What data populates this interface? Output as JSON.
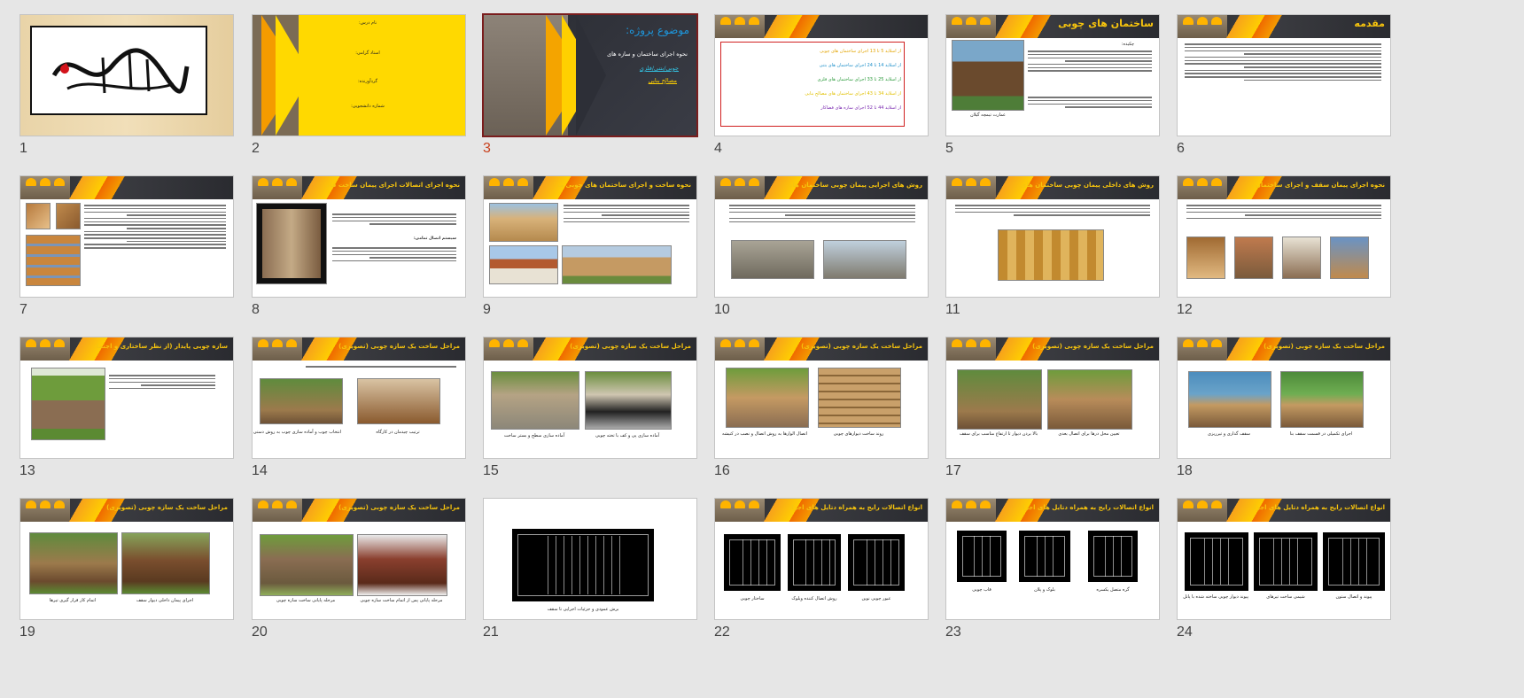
{
  "slides": [
    {
      "num": "1"
    },
    {
      "num": "2",
      "fields": [
        "نام درس:",
        "استاد گرامی:",
        "گردآورنده:",
        "شماره دانشجویی:"
      ]
    },
    {
      "num": "3",
      "title": "موضوع پروژه:",
      "l1": "نحوه اجرای ساختمان و سازه های",
      "l2": "چوبی/بتنی/فلزی",
      "l3": "مصالح بنایی"
    },
    {
      "num": "4",
      "rows": [
        "از اسلاید 5 تا 13 اجرای ساختمان های چوبی",
        "از اسلاید 14 تا 24 اجرای ساختمان های بتنی",
        "از اسلاید 25 تا 33 اجرای ساختمان های فلزی",
        "از اسلاید 34 تا 43 اجرای ساختمان های مصالح بنایی",
        "از اسلاید 44 تا 52 اجرای سازه های فضاکار"
      ],
      "row_colors": [
        "#e3a400",
        "#1d8fc9",
        "#2a9a3a",
        "#e0c000",
        "#7a2ab0"
      ]
    },
    {
      "num": "5",
      "title": "ساختمان های چوبی",
      "caption": "عمارت تیمچه گیلان",
      "intro": "چکیده:"
    },
    {
      "num": "6",
      "title": "مقدمه"
    },
    {
      "num": "7"
    },
    {
      "num": "8",
      "title": "نحوه اجرای اتصالات اجرای پیمان ساخت قاب چوبی مقاوم در برابر زلزله",
      "sub": "سیستم اتصال تمامی:"
    },
    {
      "num": "9",
      "title": "نحوه ساخت و اجرای ساختمان های چوبی مقاوم در برابر زلزله"
    },
    {
      "num": "10",
      "title": "روش های اجرایی پیمان چوبی ساختمان های چوبی مقاوم در برابر زلزله"
    },
    {
      "num": "11",
      "title": "روش های داخلی پیمان چوبی ساختمان های چوبی مقاوم در برابر زلزله"
    },
    {
      "num": "12",
      "title": "نحوه اجرای پیمان سقف و اجرای ساختمان های چوبی مقاوم در برابر زلزله"
    },
    {
      "num": "13",
      "title": "سازه چوبی پایدار (از نظر ساختاری و اجتماعی)"
    },
    {
      "num": "14",
      "title": "مراحل ساخت یک سازه چوبی (تصویری)",
      "caps": [
        "انتخاب چوب و آماده سازی چوب به روش دستی در کارگاه",
        "ترتیب چیدمان در کارگاه"
      ]
    },
    {
      "num": "15",
      "title": "مراحل ساخت یک سازه چوبی (تصویری)",
      "caps": [
        "آماده سازی سطح و بستر ساخت",
        "آماده سازی پی و کف با تخته چوبی"
      ]
    },
    {
      "num": "16",
      "title": "مراحل ساخت یک سازه چوبی (تصویری)",
      "caps": [
        "اتصال الوارها به روش اتصال و نصب در کنیشه",
        "روند ساخت دیوارهای چوبی"
      ]
    },
    {
      "num": "17",
      "title": "مراحل ساخت یک سازه چوبی (تصویری)",
      "caps": [
        "بالا بردن دیوار تا ارتفاع مناسب برای سقف",
        "تعیین محل درها برای اتصال بعدی"
      ]
    },
    {
      "num": "18",
      "title": "مراحل ساخت یک سازه چوبی (تصویری)",
      "caps": [
        "سقف گذاری و تیرریزی",
        "اجرای تکمیلی در قسمت سقف بنا"
      ]
    },
    {
      "num": "19",
      "title": "مراحل ساخت یک سازه چوبی (تصویری)",
      "caps": [
        "اتمام کار قرار گیری تیرها",
        "اجرای پیمان داخلی دیوار سقف"
      ]
    },
    {
      "num": "20",
      "title": "مراحل ساخت یک سازه چوبی (تصویری)",
      "caps": [
        "مرحله پایانی ساخت سازه چوبی",
        "مرحله پایانی پس از اتمام ساخت سازه چوبی"
      ]
    },
    {
      "num": "21",
      "caps": [
        "برش عمودی و جزئیات اجرایی تا سقف"
      ]
    },
    {
      "num": "22",
      "title": "انواع اتصالات رایج به همراه دتایل های اجرایی",
      "caps": [
        "ساختار چوبی",
        "روش اتصال کننده ویلوک",
        "عبور چوبی نوین"
      ]
    },
    {
      "num": "23",
      "title": "انواع اتصالات رایج به همراه دتایل های اجرایی",
      "caps": [
        "قاب چوبی",
        "بلوک و پلان",
        "گره متصل یکسره"
      ]
    },
    {
      "num": "24",
      "title": "انواع اتصالات رایج به همراه دتایل های اجرایی",
      "caps": [
        "پیوند دیوار چوبی ساخته شده با پانل",
        "شیمی ساخت تیرهای",
        "پیوند و اتصال ستون"
      ]
    }
  ],
  "selected": "3",
  "colors": {
    "header_title": "#f7c40d",
    "selection_border": "#7a1d1d",
    "selected_number": "#c8401c",
    "accent_orange": "#f49b00",
    "accent_yellow": "#ffd000"
  }
}
